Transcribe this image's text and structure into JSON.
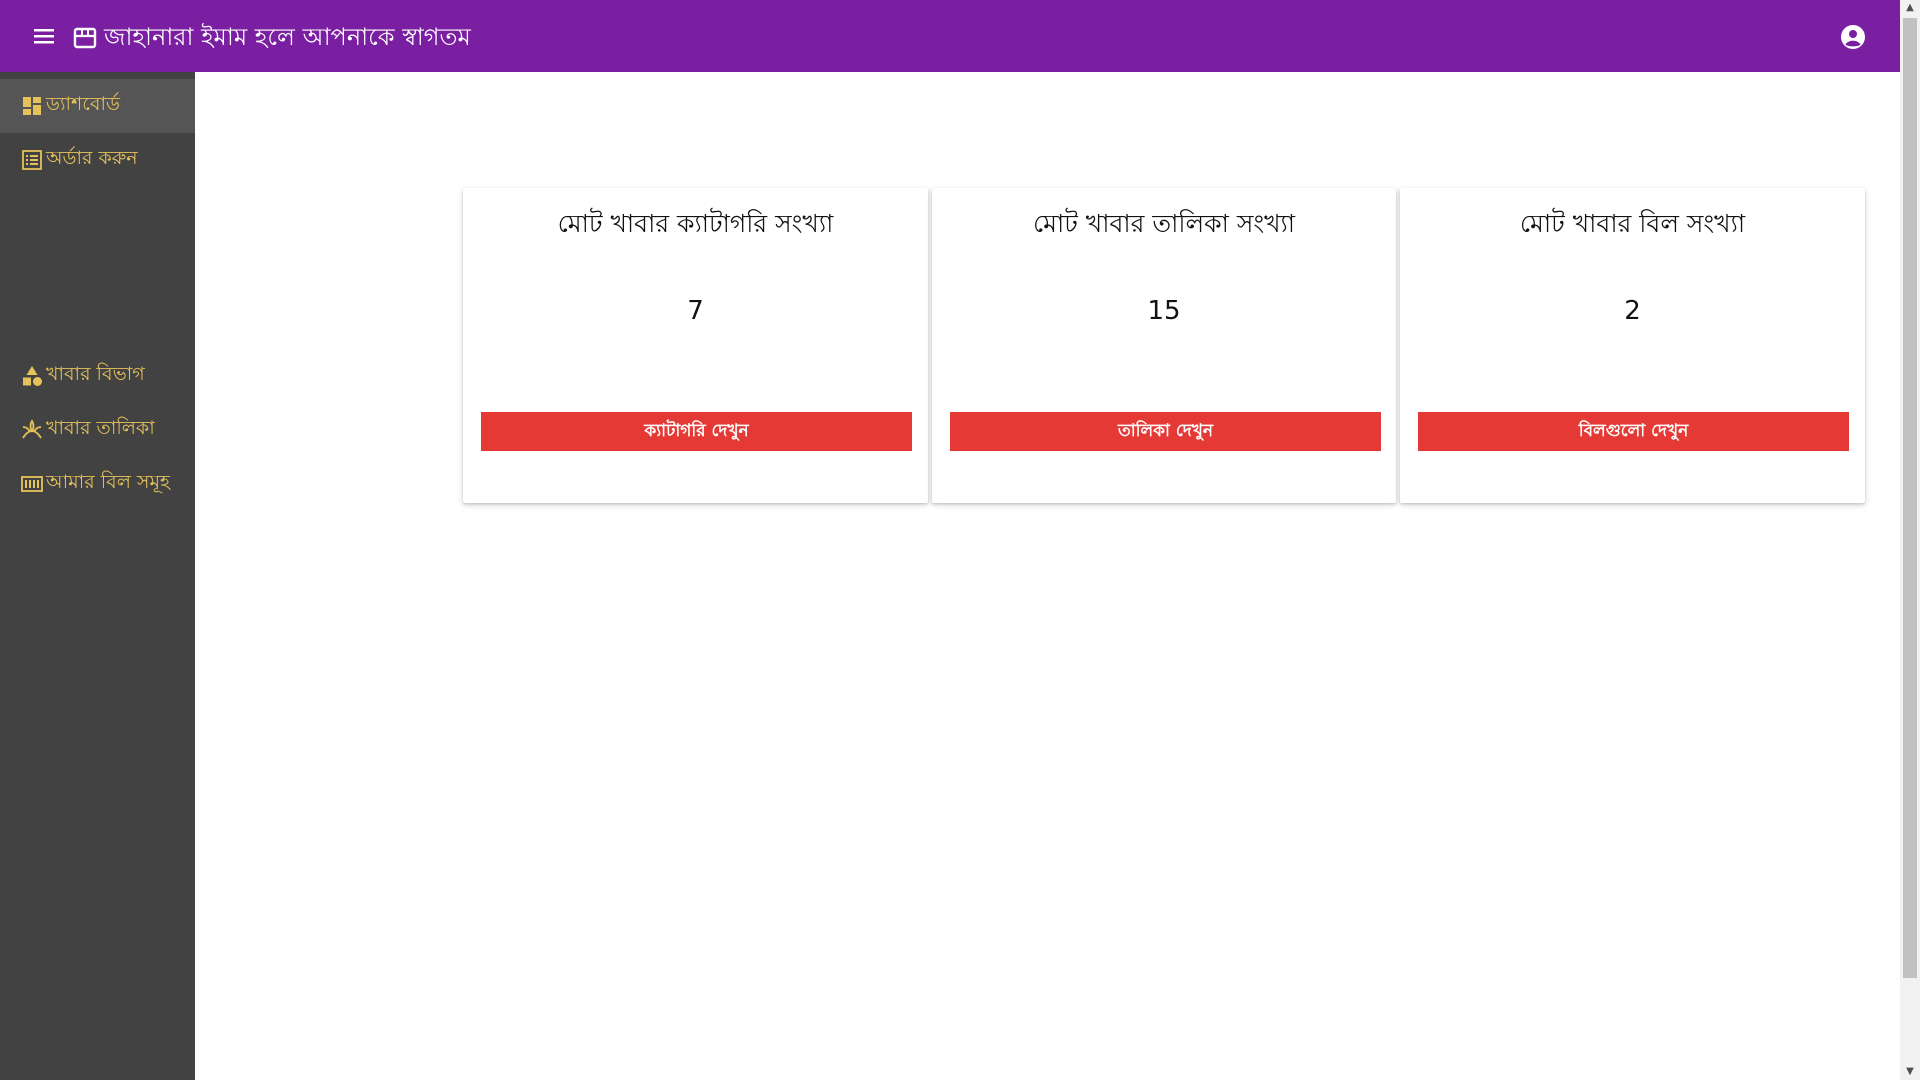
{
  "header": {
    "title": "জাহানারা ইমাম হলে আপনাকে স্বাগতম",
    "menu_icon": "menu-icon",
    "brand_icon": "store-icon",
    "account_icon": "account-circle-icon",
    "color": "#7b1fa2"
  },
  "sidebar": {
    "color": "#424242",
    "accent": "#e6c25a",
    "items": [
      {
        "label": "ড্যাশবোর্ড",
        "icon": "dashboard-icon",
        "active": true
      },
      {
        "label": "অর্ডার করুন",
        "icon": "list-icon",
        "active": false
      },
      {
        "label": "খাবার বিভাগ",
        "icon": "category-icon",
        "active": false
      },
      {
        "label": "খাবার তালিকা",
        "icon": "spa-icon",
        "active": false
      },
      {
        "label": "আমার বিল সমূহ",
        "icon": "bill-icon",
        "active": false
      }
    ]
  },
  "cards": [
    {
      "title": "মোট খাবার ক্যাটাগরি সংখ্যা",
      "count": "7",
      "button": "ক্যাটাগরি দেখুন"
    },
    {
      "title": "মোট খাবার তালিকা সংখ্যা",
      "count": "15",
      "button": "তালিকা দেখুন"
    },
    {
      "title": "মোট খাবার বিল সংখ্যা",
      "count": "2",
      "button": "বিলগুলো দেখুন"
    }
  ],
  "button_color": "#e53935"
}
